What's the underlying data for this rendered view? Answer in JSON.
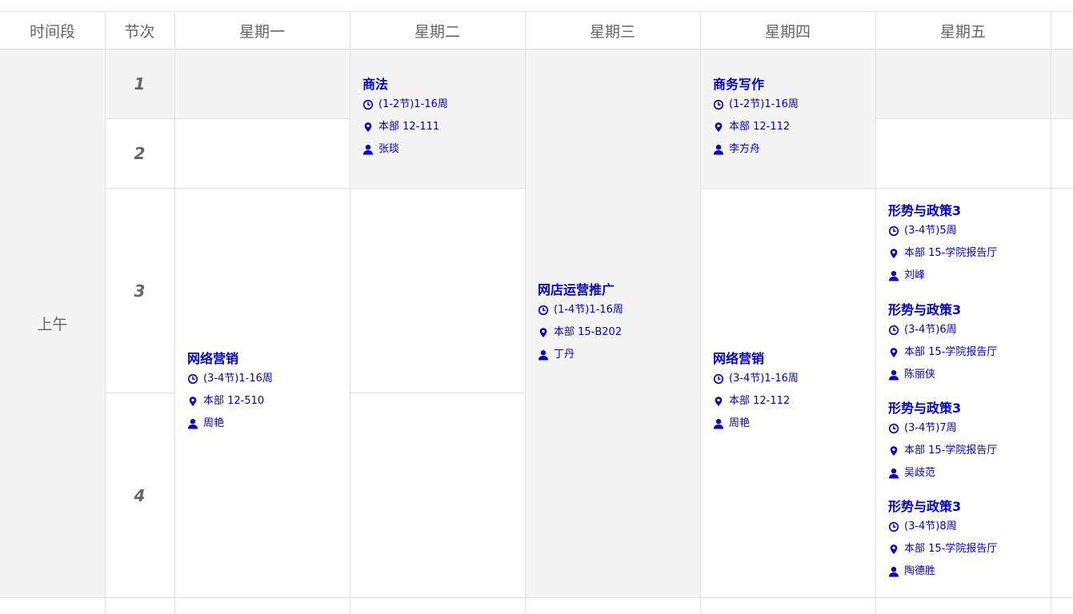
{
  "header": {
    "time_period": "时间段",
    "section": "节次",
    "days": [
      "星期一",
      "星期二",
      "星期三",
      "星期四",
      "星期五"
    ]
  },
  "period": "上午",
  "sections": [
    "1",
    "2",
    "3",
    "4"
  ],
  "colors": {
    "course_text": "#0000cc",
    "header_text": "#666666",
    "gray_bg": "#f4f4f4",
    "border": "#e3e3e3"
  },
  "icons": {
    "time": "clock-icon",
    "location": "location-pin-icon",
    "teacher": "person-icon"
  },
  "courses": {
    "tue_shangfa": {
      "name": "商法",
      "time": "(1-2节)1-16周",
      "location": "本部 12-111",
      "teacher": "张琰"
    },
    "thu_shangwu": {
      "name": "商务写作",
      "time": "(1-2节)1-16周",
      "location": "本部 12-112",
      "teacher": "李方舟"
    },
    "mon_wangluo": {
      "name": "网络营销",
      "time": "(3-4节)1-16周",
      "location": "本部 12-510",
      "teacher": "周艳"
    },
    "wed_wangdian": {
      "name": "网店运营推广",
      "time": "(1-4节)1-16周",
      "location": "本部 15-B202",
      "teacher": "丁丹"
    },
    "thu_wangluo": {
      "name": "网络营销",
      "time": "(3-4节)1-16周",
      "location": "本部 12-112",
      "teacher": "周艳"
    },
    "fri_xingshi": [
      {
        "name": "形势与政策3",
        "time": "(3-4节)5周",
        "location": "本部 15-学院报告厅",
        "teacher": "刘峰"
      },
      {
        "name": "形势与政策3",
        "time": "(3-4节)6周",
        "location": "本部 15-学院报告厅",
        "teacher": "陈丽侠"
      },
      {
        "name": "形势与政策3",
        "time": "(3-4节)7周",
        "location": "本部 15-学院报告厅",
        "teacher": "吴歧范"
      },
      {
        "name": "形势与政策3",
        "time": "(3-4节)8周",
        "location": "本部 15-学院报告厅",
        "teacher": "陶德胜"
      }
    ]
  }
}
